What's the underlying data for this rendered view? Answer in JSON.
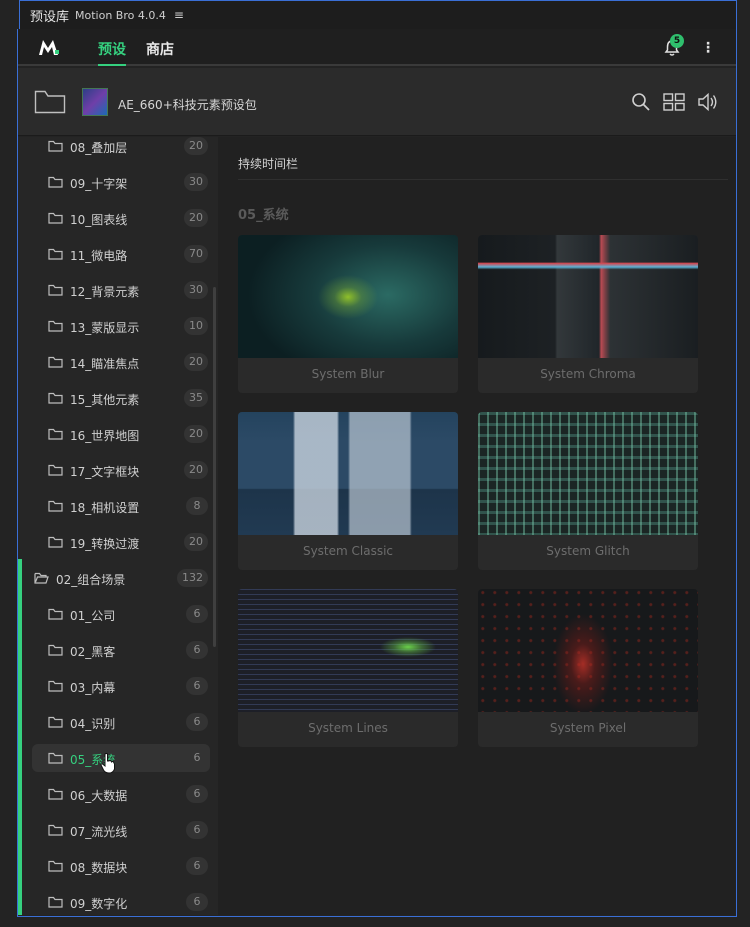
{
  "window": {
    "title": "预设库",
    "app_name": "Motion Bro 4.0.4",
    "menu_glyph": "≡"
  },
  "nav": {
    "tabs": [
      {
        "label": "预设",
        "active": true
      },
      {
        "label": "商店",
        "active": false
      }
    ],
    "notification_count": "5",
    "more_glyph": "⋮"
  },
  "header": {
    "pack_name": "AE_660+科技元素预设包"
  },
  "colors": {
    "accent": "#35d07f",
    "frame_border": "#3a6fd6"
  },
  "sidebar": {
    "items": [
      {
        "label": "08_叠加层",
        "count": "20"
      },
      {
        "label": "09_十字架",
        "count": "30"
      },
      {
        "label": "10_图表线",
        "count": "20"
      },
      {
        "label": "11_微电路",
        "count": "70"
      },
      {
        "label": "12_背景元素",
        "count": "30"
      },
      {
        "label": "13_蒙版显示",
        "count": "10"
      },
      {
        "label": "14_瞄准焦点",
        "count": "20"
      },
      {
        "label": "15_其他元素",
        "count": "35"
      },
      {
        "label": "16_世界地图",
        "count": "20"
      },
      {
        "label": "17_文字框块",
        "count": "20"
      },
      {
        "label": "18_相机设置",
        "count": "8"
      },
      {
        "label": "19_转换过渡",
        "count": "20"
      }
    ],
    "group": {
      "label": "02_组合场景",
      "count": "132"
    },
    "group_items": [
      {
        "label": "01_公司",
        "count": "6"
      },
      {
        "label": "02_黑客",
        "count": "6"
      },
      {
        "label": "03_内幕",
        "count": "6"
      },
      {
        "label": "04_识别",
        "count": "6"
      },
      {
        "label": "05_系统",
        "count": "6",
        "active": true
      },
      {
        "label": "06_大数据",
        "count": "6"
      },
      {
        "label": "07_流光线",
        "count": "6"
      },
      {
        "label": "08_数据块",
        "count": "6"
      },
      {
        "label": "09_数字化",
        "count": "6"
      }
    ]
  },
  "main": {
    "timeline_label": "持续时间栏",
    "section_title": "05_系统",
    "presets": [
      {
        "name": "System Blur"
      },
      {
        "name": "System Chroma"
      },
      {
        "name": "System Classic"
      },
      {
        "name": "System Glitch"
      },
      {
        "name": "System Lines"
      },
      {
        "name": "System Pixel"
      }
    ]
  }
}
